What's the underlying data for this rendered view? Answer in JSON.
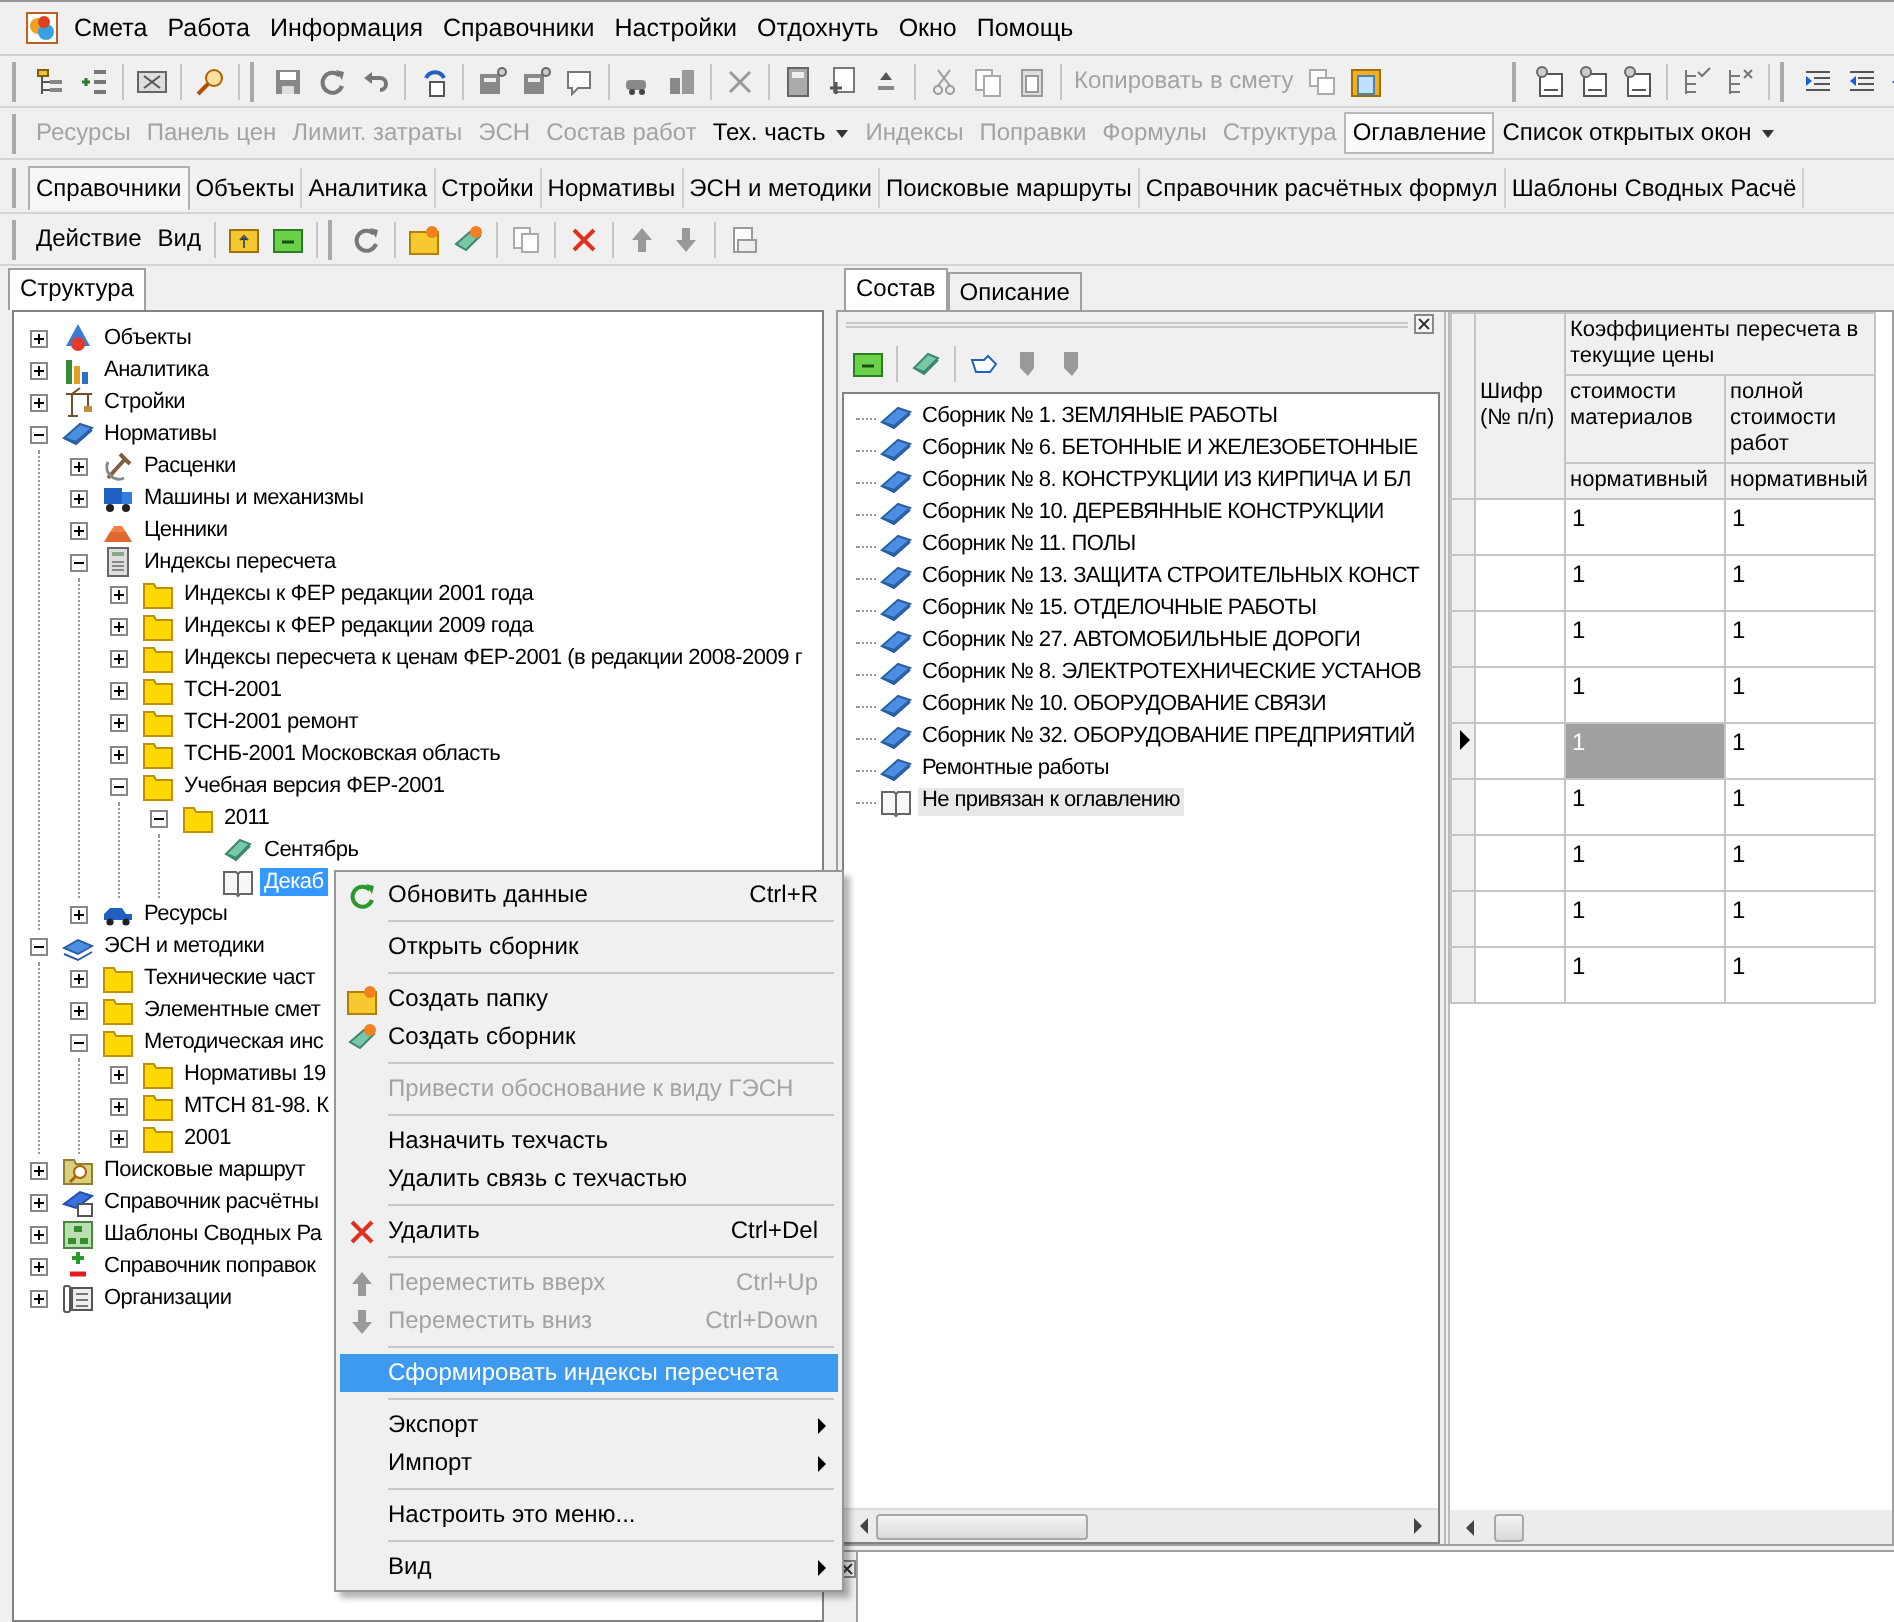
{
  "menu_bar": {
    "items": [
      "Смета",
      "Работа",
      "Информация",
      "Справочники",
      "Настройки",
      "Отдохнуть",
      "Окно",
      "Помощь"
    ]
  },
  "toolbar": {
    "copy_to_estimate": {
      "label": "Копировать в смету",
      "disabled": true
    }
  },
  "panels_bar": [
    {
      "label": "Ресурсы",
      "disabled": true,
      "dropdown": false,
      "selected": false
    },
    {
      "label": "Панель цен",
      "disabled": true,
      "dropdown": false,
      "selected": false
    },
    {
      "label": "Лимит. затраты",
      "disabled": true,
      "dropdown": false,
      "selected": false
    },
    {
      "label": "ЭСН",
      "disabled": true,
      "dropdown": false,
      "selected": false
    },
    {
      "label": "Состав работ",
      "disabled": true,
      "dropdown": false,
      "selected": false
    },
    {
      "label": "Тех. часть",
      "disabled": false,
      "dropdown": true,
      "selected": false
    },
    {
      "label": "Индексы",
      "disabled": true,
      "dropdown": false,
      "selected": false
    },
    {
      "label": "Поправки",
      "disabled": true,
      "dropdown": false,
      "selected": false
    },
    {
      "label": "Формулы",
      "disabled": true,
      "dropdown": false,
      "selected": false
    },
    {
      "label": "Структура",
      "disabled": true,
      "dropdown": false,
      "selected": false
    },
    {
      "label": "Оглавление",
      "disabled": false,
      "dropdown": false,
      "selected": true
    },
    {
      "label": "Список открытых окон",
      "disabled": false,
      "dropdown": true,
      "selected": false
    }
  ],
  "section_tabs": [
    {
      "label": "Справочники",
      "selected": true
    },
    {
      "label": "Объекты",
      "selected": false
    },
    {
      "label": "Аналитика",
      "selected": false
    },
    {
      "label": "Стройки",
      "selected": false
    },
    {
      "label": "Нормативы",
      "selected": false
    },
    {
      "label": "ЭСН и методики",
      "selected": false
    },
    {
      "label": "Поисковые маршруты",
      "selected": false
    },
    {
      "label": "Справочник расчётных формул",
      "selected": false
    },
    {
      "label": "Шаблоны Сводных Расчё",
      "selected": false
    }
  ],
  "action_bar": {
    "menus": [
      "Действие",
      "Вид"
    ]
  },
  "left_pane": {
    "tabs": [
      {
        "label": "Структура",
        "selected": true
      }
    ],
    "tree": [
      {
        "label": "Объекты",
        "kind": "objects",
        "expanded": false,
        "selected": false
      },
      {
        "label": "Аналитика",
        "kind": "chart",
        "expanded": false,
        "selected": false
      },
      {
        "label": "Стройки",
        "kind": "crane",
        "expanded": false,
        "selected": false
      },
      {
        "label": "Нормативы",
        "kind": "book",
        "expanded": true,
        "selected": false,
        "children": [
          {
            "label": "Расценки",
            "kind": "tools",
            "expanded": false,
            "selected": false
          },
          {
            "label": "Машины и механизмы",
            "kind": "truck",
            "expanded": false,
            "selected": false
          },
          {
            "label": "Ценники",
            "kind": "bricks",
            "expanded": false,
            "selected": false
          },
          {
            "label": "Индексы пересчета",
            "kind": "calculator",
            "expanded": true,
            "selected": false,
            "children": [
              {
                "label": "Индексы к ФЕР редакции 2001 года",
                "kind": "folder",
                "expanded": false,
                "selected": false
              },
              {
                "label": "Индексы к ФЕР редакции 2009 года",
                "kind": "folder",
                "expanded": false,
                "selected": false
              },
              {
                "label": "Индексы пересчета к ценам ФЕР-2001 (в редакции 2008-2009 г",
                "kind": "folder",
                "expanded": false,
                "selected": false
              },
              {
                "label": "ТСН-2001",
                "kind": "folder",
                "expanded": false,
                "selected": false
              },
              {
                "label": "ТСН-2001 ремонт",
                "kind": "folder",
                "expanded": false,
                "selected": false
              },
              {
                "label": "ТСНБ-2001 Московская область",
                "kind": "folder",
                "expanded": false,
                "selected": false
              },
              {
                "label": "Учебная версия ФЕР-2001",
                "kind": "folder",
                "expanded": true,
                "selected": false,
                "children": [
                  {
                    "label": "2011",
                    "kind": "folder",
                    "expanded": true,
                    "selected": false,
                    "children": [
                      {
                        "label": "Сентябрь",
                        "kind": "green-book",
                        "selected": false
                      },
                      {
                        "label": "Декаб",
                        "kind": "open-book",
                        "selected": true
                      }
                    ]
                  }
                ]
              }
            ]
          },
          {
            "label": "Ресурсы",
            "kind": "car",
            "expanded": false,
            "selected": false
          }
        ]
      },
      {
        "label": "ЭСН и методики",
        "kind": "books",
        "expanded": true,
        "selected": false,
        "children": [
          {
            "label": "Технические част",
            "kind": "folder",
            "expanded": false,
            "selected": false
          },
          {
            "label": "Элементные смет",
            "kind": "folder",
            "expanded": false,
            "selected": false
          },
          {
            "label": "Методическая инс",
            "kind": "folder",
            "expanded": true,
            "selected": false,
            "children": [
              {
                "label": "Нормативы 19",
                "kind": "folder",
                "expanded": false,
                "selected": false
              },
              {
                "label": "МТСН 81-98. К",
                "kind": "folder",
                "expanded": false,
                "selected": false
              },
              {
                "label": "2001",
                "kind": "folder",
                "expanded": false,
                "selected": false
              }
            ]
          }
        ]
      },
      {
        "label": "Поисковые маршрут",
        "kind": "search-folder",
        "expanded": false,
        "selected": false
      },
      {
        "label": "Справочник расчётны",
        "kind": "formula-book",
        "expanded": false,
        "selected": false
      },
      {
        "label": "Шаблоны Сводных Ра",
        "kind": "diagram",
        "expanded": false,
        "selected": false
      },
      {
        "label": "Справочник поправок",
        "kind": "plus-minus",
        "expanded": false,
        "selected": false
      },
      {
        "label": "Организации",
        "kind": "device",
        "expanded": false,
        "selected": false
      }
    ]
  },
  "right_pane": {
    "tabs": [
      {
        "label": "Состав",
        "selected": true
      },
      {
        "label": "Описание",
        "selected": false
      }
    ],
    "contents": [
      {
        "label": "Сборник № 1. ЗЕМЛЯНЫЕ РАБОТЫ",
        "kind": "book",
        "selected": false
      },
      {
        "label": "Сборник № 6. БЕТОННЫЕ И ЖЕЛЕЗОБЕТОННЫЕ",
        "kind": "book",
        "selected": false
      },
      {
        "label": "Сборник № 8. КОНСТРУКЦИИ ИЗ КИРПИЧА И БЛ",
        "kind": "book",
        "selected": false
      },
      {
        "label": "Сборник № 10. ДЕРЕВЯННЫЕ КОНСТРУКЦИИ",
        "kind": "book",
        "selected": false
      },
      {
        "label": "Сборник № 11. ПОЛЫ",
        "kind": "book",
        "selected": false
      },
      {
        "label": "Сборник № 13. ЗАЩИТА СТРОИТЕЛЬНЫХ КОНСТ",
        "kind": "book",
        "selected": false
      },
      {
        "label": "Сборник № 15. ОТДЕЛОЧНЫЕ РАБОТЫ",
        "kind": "book",
        "selected": false
      },
      {
        "label": "Сборник № 27. АВТОМОБИЛЬНЫЕ ДОРОГИ",
        "kind": "book",
        "selected": false
      },
      {
        "label": "Сборник № 8. ЭЛЕКТРОТЕХНИЧЕСКИЕ УСТАНОВ",
        "kind": "book",
        "selected": false
      },
      {
        "label": "Сборник № 10. ОБОРУДОВАНИЕ СВЯЗИ",
        "kind": "book",
        "selected": false
      },
      {
        "label": "Сборник № 32. ОБОРУДОВАНИЕ ПРЕДПРИЯТИЙ",
        "kind": "book",
        "selected": false
      },
      {
        "label": "Ремонтные работы",
        "kind": "book",
        "selected": false
      },
      {
        "label": "Не привязан к оглавлению",
        "kind": "open-book",
        "selected": true
      }
    ],
    "grid": {
      "code_header": "Шифр (№ п/п)",
      "group_header": "Коэффициенты пересчета в текущие цены",
      "columns": [
        {
          "header": "стоимости материалов",
          "subheader": "нормативный"
        },
        {
          "header": "полной стоимости работ",
          "subheader": "нормативный"
        }
      ],
      "rows": [
        {
          "values": [
            "1",
            "1"
          ],
          "current": false
        },
        {
          "values": [
            "1",
            "1"
          ],
          "current": false
        },
        {
          "values": [
            "1",
            "1"
          ],
          "current": false
        },
        {
          "values": [
            "1",
            "1"
          ],
          "current": false
        },
        {
          "values": [
            "1",
            "1"
          ],
          "current": true
        },
        {
          "values": [
            "1",
            "1"
          ],
          "current": false
        },
        {
          "values": [
            "1",
            "1"
          ],
          "current": false
        },
        {
          "values": [
            "1",
            "1"
          ],
          "current": false
        },
        {
          "values": [
            "1",
            "1"
          ],
          "current": false
        }
      ]
    }
  },
  "context_menu": [
    {
      "kind": "item",
      "label": "Обновить данные",
      "shortcut": "Ctrl+R",
      "disabled": false,
      "selected": false,
      "submenu": false
    },
    {
      "kind": "separator"
    },
    {
      "kind": "item",
      "label": "Открыть сборник",
      "disabled": false,
      "selected": false,
      "submenu": false
    },
    {
      "kind": "separator"
    },
    {
      "kind": "item",
      "label": "Создать папку",
      "disabled": false,
      "selected": false,
      "submenu": false
    },
    {
      "kind": "item",
      "label": "Создать сборник",
      "disabled": false,
      "selected": false,
      "submenu": false
    },
    {
      "kind": "separator"
    },
    {
      "kind": "item",
      "label": "Привести обоснование к виду ГЭСН",
      "disabled": true,
      "selected": false,
      "submenu": false
    },
    {
      "kind": "separator"
    },
    {
      "kind": "item",
      "label": "Назначить техчасть",
      "disabled": false,
      "selected": false,
      "submenu": false
    },
    {
      "kind": "item",
      "label": "Удалить связь с техчастью",
      "disabled": false,
      "selected": false,
      "submenu": false
    },
    {
      "kind": "separator"
    },
    {
      "kind": "item",
      "label": "Удалить",
      "shortcut": "Ctrl+Del",
      "disabled": false,
      "selected": false,
      "submenu": false
    },
    {
      "kind": "separator"
    },
    {
      "kind": "item",
      "label": "Переместить вверх",
      "shortcut": "Ctrl+Up",
      "disabled": true,
      "selected": false,
      "submenu": false
    },
    {
      "kind": "item",
      "label": "Переместить вниз",
      "shortcut": "Ctrl+Down",
      "disabled": true,
      "selected": false,
      "submenu": false
    },
    {
      "kind": "separator"
    },
    {
      "kind": "item",
      "label": "Сформировать индексы пересчета",
      "disabled": false,
      "selected": true,
      "submenu": false
    },
    {
      "kind": "separator"
    },
    {
      "kind": "item",
      "label": "Экспорт",
      "disabled": false,
      "selected": false,
      "submenu": true
    },
    {
      "kind": "item",
      "label": "Импорт",
      "disabled": false,
      "selected": false,
      "submenu": true
    },
    {
      "kind": "separator"
    },
    {
      "kind": "item",
      "label": "Настроить это меню...",
      "disabled": false,
      "selected": false,
      "submenu": false
    },
    {
      "kind": "separator"
    },
    {
      "kind": "item",
      "label": "Вид",
      "disabled": false,
      "selected": false,
      "submenu": true
    }
  ]
}
